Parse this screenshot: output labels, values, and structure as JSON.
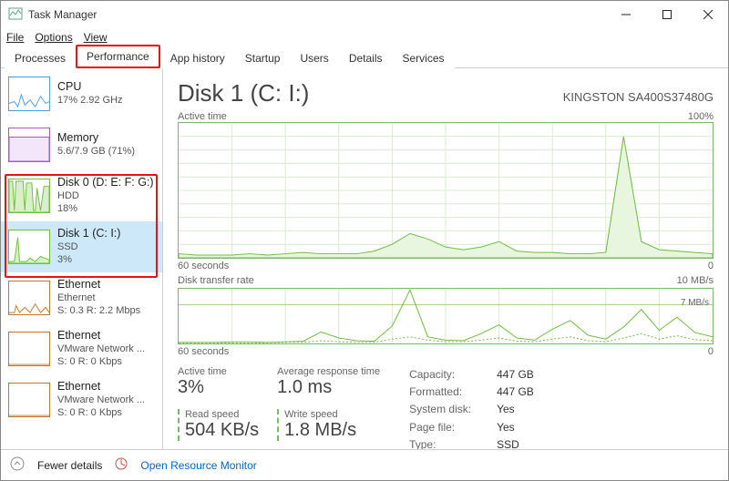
{
  "window": {
    "title": "Task Manager"
  },
  "menu": {
    "file": "File",
    "options": "Options",
    "view": "View"
  },
  "tabs": {
    "processes": "Processes",
    "performance": "Performance",
    "app_history": "App history",
    "startup": "Startup",
    "users": "Users",
    "details": "Details",
    "services": "Services"
  },
  "sidebar": {
    "items": [
      {
        "label": "CPU",
        "sub1": "17% 2.92 GHz",
        "sub2": "",
        "color": "#4aa0e8"
      },
      {
        "label": "Memory",
        "sub1": "5.6/7.9 GB (71%)",
        "sub2": "",
        "color": "#a15cc8"
      },
      {
        "label": "Disk 0 (D: E: F: G:)",
        "sub1": "HDD",
        "sub2": "18%",
        "color": "#6fbf40"
      },
      {
        "label": "Disk 1 (C: I:)",
        "sub1": "SSD",
        "sub2": "3%",
        "color": "#6fbf40"
      },
      {
        "label": "Ethernet",
        "sub1": "Ethernet",
        "sub2": "S: 0.3 R: 2.2 Mbps",
        "color": "#c8762d"
      },
      {
        "label": "Ethernet",
        "sub1": "VMware Network ...",
        "sub2": "S: 0 R: 0 Kbps",
        "color": "#c8762d"
      },
      {
        "label": "Ethernet",
        "sub1": "VMware Network ...",
        "sub2": "S: 0 R: 0 Kbps",
        "color": "#c8762d"
      }
    ]
  },
  "main": {
    "title": "Disk 1 (C: I:)",
    "model": "KINGSTON SA400S37480G",
    "chart1_label": "Active time",
    "chart1_max": "100%",
    "chart1_xmin": "60 seconds",
    "chart1_xmax": "0",
    "chart2_label": "Disk transfer rate",
    "chart2_max": "10 MB/s",
    "chart2_guide": "7 MB/s",
    "chart2_xmin": "60 seconds",
    "chart2_xmax": "0",
    "stats": {
      "active_time_label": "Active time",
      "active_time_value": "3%",
      "avg_resp_label": "Average response time",
      "avg_resp_value": "1.0 ms",
      "read_label": "Read speed",
      "read_value": "504 KB/s",
      "write_label": "Write speed",
      "write_value": "1.8 MB/s"
    },
    "info": {
      "capacity_k": "Capacity:",
      "capacity_v": "447 GB",
      "formatted_k": "Formatted:",
      "formatted_v": "447 GB",
      "system_k": "System disk:",
      "system_v": "Yes",
      "page_k": "Page file:",
      "page_v": "Yes",
      "type_k": "Type:",
      "type_v": "SSD"
    }
  },
  "footer": {
    "fewer": "Fewer details",
    "resmon": "Open Resource Monitor"
  },
  "chart_data": [
    {
      "type": "area",
      "title": "Active time",
      "ylabel": "%",
      "ylim": [
        0,
        100
      ],
      "xlabel": "seconds ago",
      "x": [
        60,
        58,
        56,
        54,
        52,
        50,
        48,
        46,
        44,
        42,
        40,
        38,
        36,
        34,
        32,
        30,
        28,
        26,
        24,
        22,
        20,
        18,
        16,
        14,
        12,
        10,
        8,
        6,
        4,
        2,
        0
      ],
      "values": [
        3,
        2,
        2,
        2,
        3,
        2,
        3,
        4,
        3,
        3,
        3,
        5,
        10,
        18,
        14,
        8,
        6,
        8,
        12,
        5,
        4,
        4,
        3,
        3,
        4,
        90,
        12,
        6,
        5,
        4,
        3
      ]
    },
    {
      "type": "line",
      "title": "Disk transfer rate",
      "ylabel": "MB/s",
      "ylim": [
        0,
        10
      ],
      "xlabel": "seconds ago",
      "x": [
        60,
        58,
        56,
        54,
        52,
        50,
        48,
        46,
        44,
        42,
        40,
        38,
        36,
        34,
        32,
        30,
        28,
        26,
        24,
        22,
        20,
        18,
        16,
        14,
        12,
        10,
        8,
        6,
        4,
        2,
        0
      ],
      "series": [
        {
          "name": "Read",
          "values": [
            0.2,
            0.2,
            0.2,
            0.3,
            0.3,
            0.2,
            0.3,
            0.4,
            2.1,
            1.0,
            0.5,
            0.4,
            3.2,
            9.8,
            1.2,
            0.6,
            0.5,
            1.8,
            3.4,
            1.0,
            0.6,
            2.6,
            4.2,
            1.5,
            0.8,
            3.0,
            6.2,
            2.4,
            4.8,
            2.0,
            1.2
          ]
        },
        {
          "name": "Write",
          "values": [
            0.1,
            0.1,
            0.1,
            0.1,
            0.1,
            0.1,
            0.2,
            0.2,
            0.5,
            0.3,
            0.2,
            0.2,
            0.8,
            1.2,
            0.6,
            0.3,
            0.3,
            0.6,
            1.0,
            0.4,
            0.3,
            0.8,
            1.2,
            0.5,
            0.3,
            1.0,
            1.8,
            0.8,
            1.4,
            0.7,
            0.5
          ]
        }
      ],
      "annotations": [
        "7 MB/s"
      ]
    }
  ]
}
